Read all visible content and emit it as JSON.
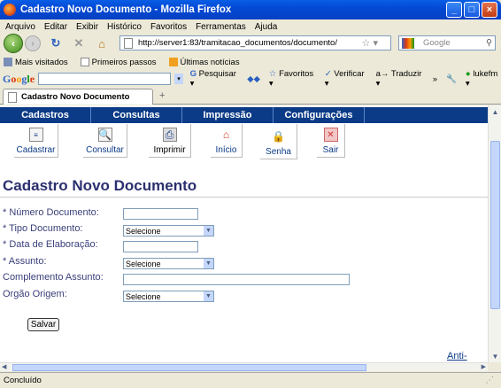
{
  "window": {
    "title": "Cadastro Novo Documento - Mozilla Firefox"
  },
  "menu": [
    "Arquivo",
    "Editar",
    "Exibir",
    "Histórico",
    "Favoritos",
    "Ferramentas",
    "Ajuda"
  ],
  "nav": {
    "url": "http://server1:83/tramitacao_documentos/documento/",
    "search_placeholder": "Google"
  },
  "bookmarks": [
    "Mais visitados",
    "Primeiros passos",
    "Últimas notícias"
  ],
  "googlebar": {
    "logo_letters": [
      "G",
      "o",
      "o",
      "g",
      "l",
      "e"
    ],
    "search_label": "Pesquisar",
    "favorites": "Favoritos",
    "verify": "Verificar",
    "translate": "Traduzir",
    "more": "»",
    "user": "lukefm"
  },
  "tab": {
    "title": "Cadastro Novo Documento"
  },
  "site_menu": [
    "Cadastros",
    "Consultas",
    "Impressão",
    "Configurações"
  ],
  "toolbar": [
    {
      "label": "Cadastrar",
      "icon": "document-icon"
    },
    {
      "label": "Consultar",
      "icon": "magnifier-icon"
    },
    {
      "label": "Imprimir",
      "icon": "printer-icon"
    },
    {
      "label": "Início",
      "icon": "home-icon"
    },
    {
      "label": "Senha",
      "icon": "lock-icon"
    },
    {
      "label": "Sair",
      "icon": "exit-icon"
    }
  ],
  "page": {
    "title": "Cadastro Novo Documento",
    "fields": [
      {
        "label": "* Número Documento:",
        "type": "text",
        "value": ""
      },
      {
        "label": "* Tipo Documento:",
        "type": "select",
        "value": "Selecione"
      },
      {
        "label": "* Data de Elaboração:",
        "type": "text",
        "value": ""
      },
      {
        "label": "* Assunto:",
        "type": "select",
        "value": "Selecione"
      },
      {
        "label": "Complemento Assunto:",
        "type": "text",
        "value": ""
      },
      {
        "label": "Orgão Origem:",
        "type": "select",
        "value": "Selecione"
      }
    ],
    "save_label": "Salvar",
    "anti_link": "Anti-IECA"
  },
  "status": {
    "text": "Concluído"
  },
  "colors": {
    "site_nav": "#0b3a86",
    "title": "#2b2f6e",
    "xp_title": "#0349d4"
  }
}
